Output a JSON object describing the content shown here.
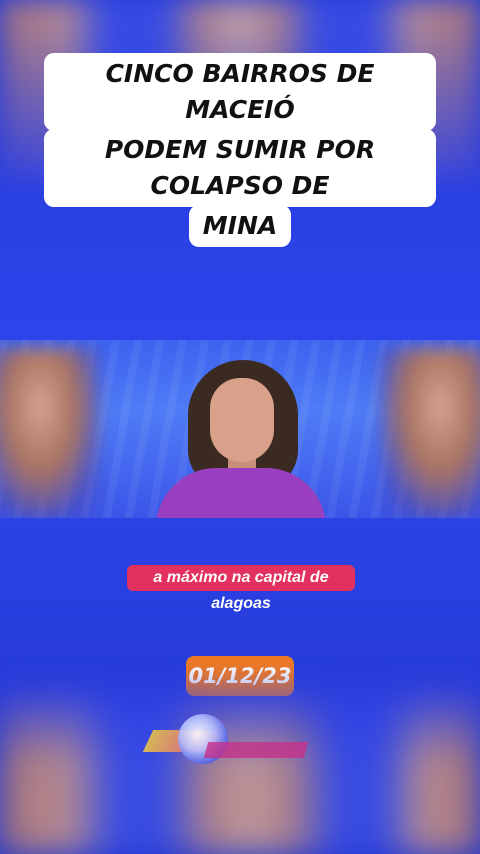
{
  "headline": {
    "lines": [
      "CINCO BAIRROS DE MACEIÓ",
      "PODEM SUMIR POR COLAPSO DE",
      "MINA"
    ]
  },
  "caption": {
    "text": "a máximo na capital de alagoas"
  },
  "date": {
    "text": "01/12/23"
  },
  "colors": {
    "background": "#2b42e4",
    "caption_bg": "#e2315e",
    "date_bg": "#f07a22",
    "headline_bg": "#ffffff"
  }
}
